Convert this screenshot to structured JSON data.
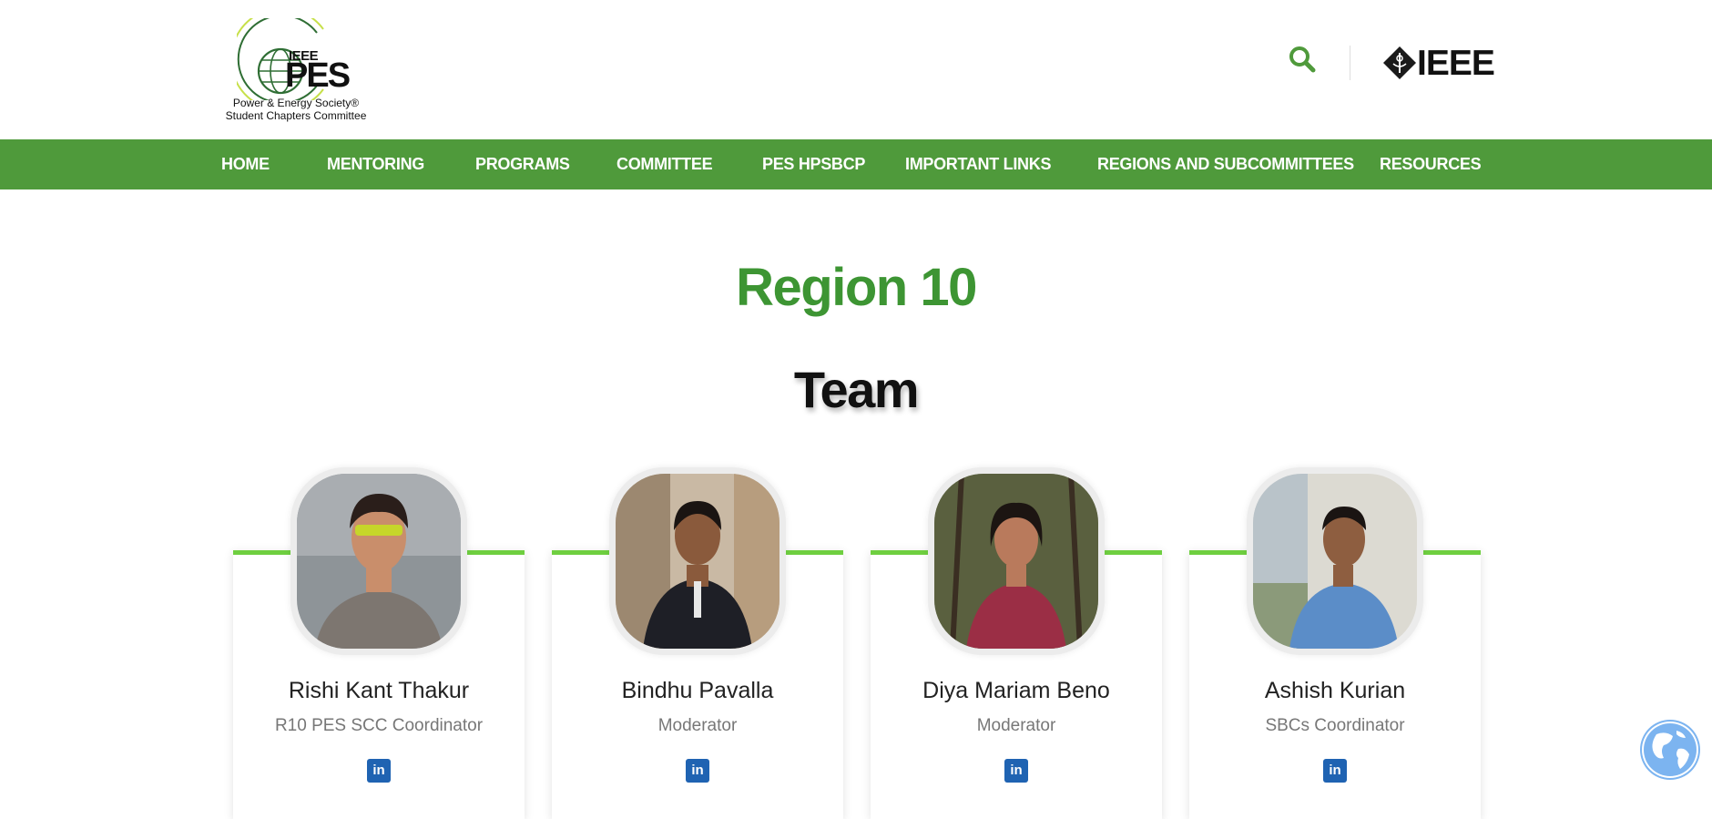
{
  "header": {
    "logo": {
      "acronym_small": "IEEE",
      "acronym_big": "PES",
      "line1": "Power & Energy Society®",
      "line2": "Student Chapters Committee"
    },
    "ieee_wordmark": "IEEE"
  },
  "nav": {
    "items": [
      {
        "label": "HOME"
      },
      {
        "label": "MENTORING"
      },
      {
        "label": "PROGRAMS"
      },
      {
        "label": "COMMITTEE"
      },
      {
        "label": "PES HPSBCP"
      },
      {
        "label": "IMPORTANT LINKS"
      },
      {
        "label": "REGIONS AND SUBCOMMITTEES"
      },
      {
        "label": "RESOURCES"
      }
    ]
  },
  "main": {
    "region_title": "Region 10",
    "team_title": "Team",
    "members": [
      {
        "name": "Rishi Kant Thakur",
        "role": "R10 PES SCC Coordinator",
        "social": "in"
      },
      {
        "name": "Bindhu Pavalla",
        "role": "Moderator",
        "social": "in"
      },
      {
        "name": "Diya Mariam Beno",
        "role": "Moderator",
        "social": "in"
      },
      {
        "name": "Ashish Kurian",
        "role": "SBCs Coordinator",
        "social": "in"
      }
    ]
  },
  "colors": {
    "nav_green": "#4f9a3b",
    "title_green": "#3d9533",
    "card_accent": "#6fcf40",
    "linkedin_blue": "#1f63b2"
  },
  "icons": {
    "search": "search-icon",
    "globe": "globe-icon",
    "linkedin": "linkedin-icon"
  }
}
